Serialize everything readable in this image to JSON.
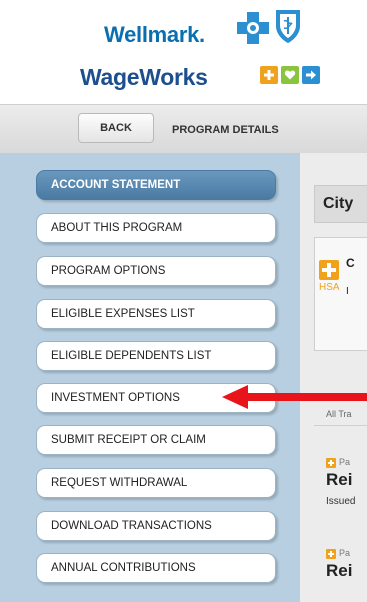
{
  "logo": {
    "wellmark": "Wellmark.",
    "wageworks": "WageWorks",
    "cross_icon": "blue-cross-icon",
    "shield_icon": "blue-shield-icon",
    "mini_icons": [
      "plus-icon",
      "heart-icon",
      "arrow-right-icon"
    ],
    "colors": {
      "wellmark": "#0a6fb0",
      "wageworks": "#1d4f8f",
      "orange": "#f1a21d",
      "green": "#8ac43f",
      "blue": "#2b8fd1"
    }
  },
  "topbar": {
    "back_label": "BACK",
    "title": "PROGRAM DETAILS"
  },
  "sidebar": {
    "items": [
      {
        "label": "ACCOUNT STATEMENT",
        "active": true
      },
      {
        "label": "ABOUT THIS PROGRAM"
      },
      {
        "label": "PROGRAM OPTIONS"
      },
      {
        "label": "ELIGIBLE EXPENSES LIST"
      },
      {
        "label": "ELIGIBLE DEPENDENTS LIST"
      },
      {
        "label": "INVESTMENT OPTIONS"
      },
      {
        "label": "SUBMIT RECEIPT OR CLAIM"
      },
      {
        "label": "REQUEST WITHDRAWAL"
      },
      {
        "label": "DOWNLOAD TRANSACTIONS"
      },
      {
        "label": "ANNUAL CONTRIBUTIONS"
      }
    ],
    "colors": {
      "background": "#b7cfe0",
      "active": "#4a7aa3"
    }
  },
  "main": {
    "city_header": "City",
    "hsa_card": {
      "badge": "HSA",
      "fragment_1": "C",
      "fragment_2": "I"
    },
    "all_transactions": "All Tra",
    "transactions": [
      {
        "kind": "Pa",
        "title": "Rei",
        "subtitle": "Issued"
      },
      {
        "kind": "Pa",
        "title": "Rei",
        "subtitle": ""
      }
    ]
  },
  "annotation": {
    "arrow_color": "#e8141a"
  }
}
